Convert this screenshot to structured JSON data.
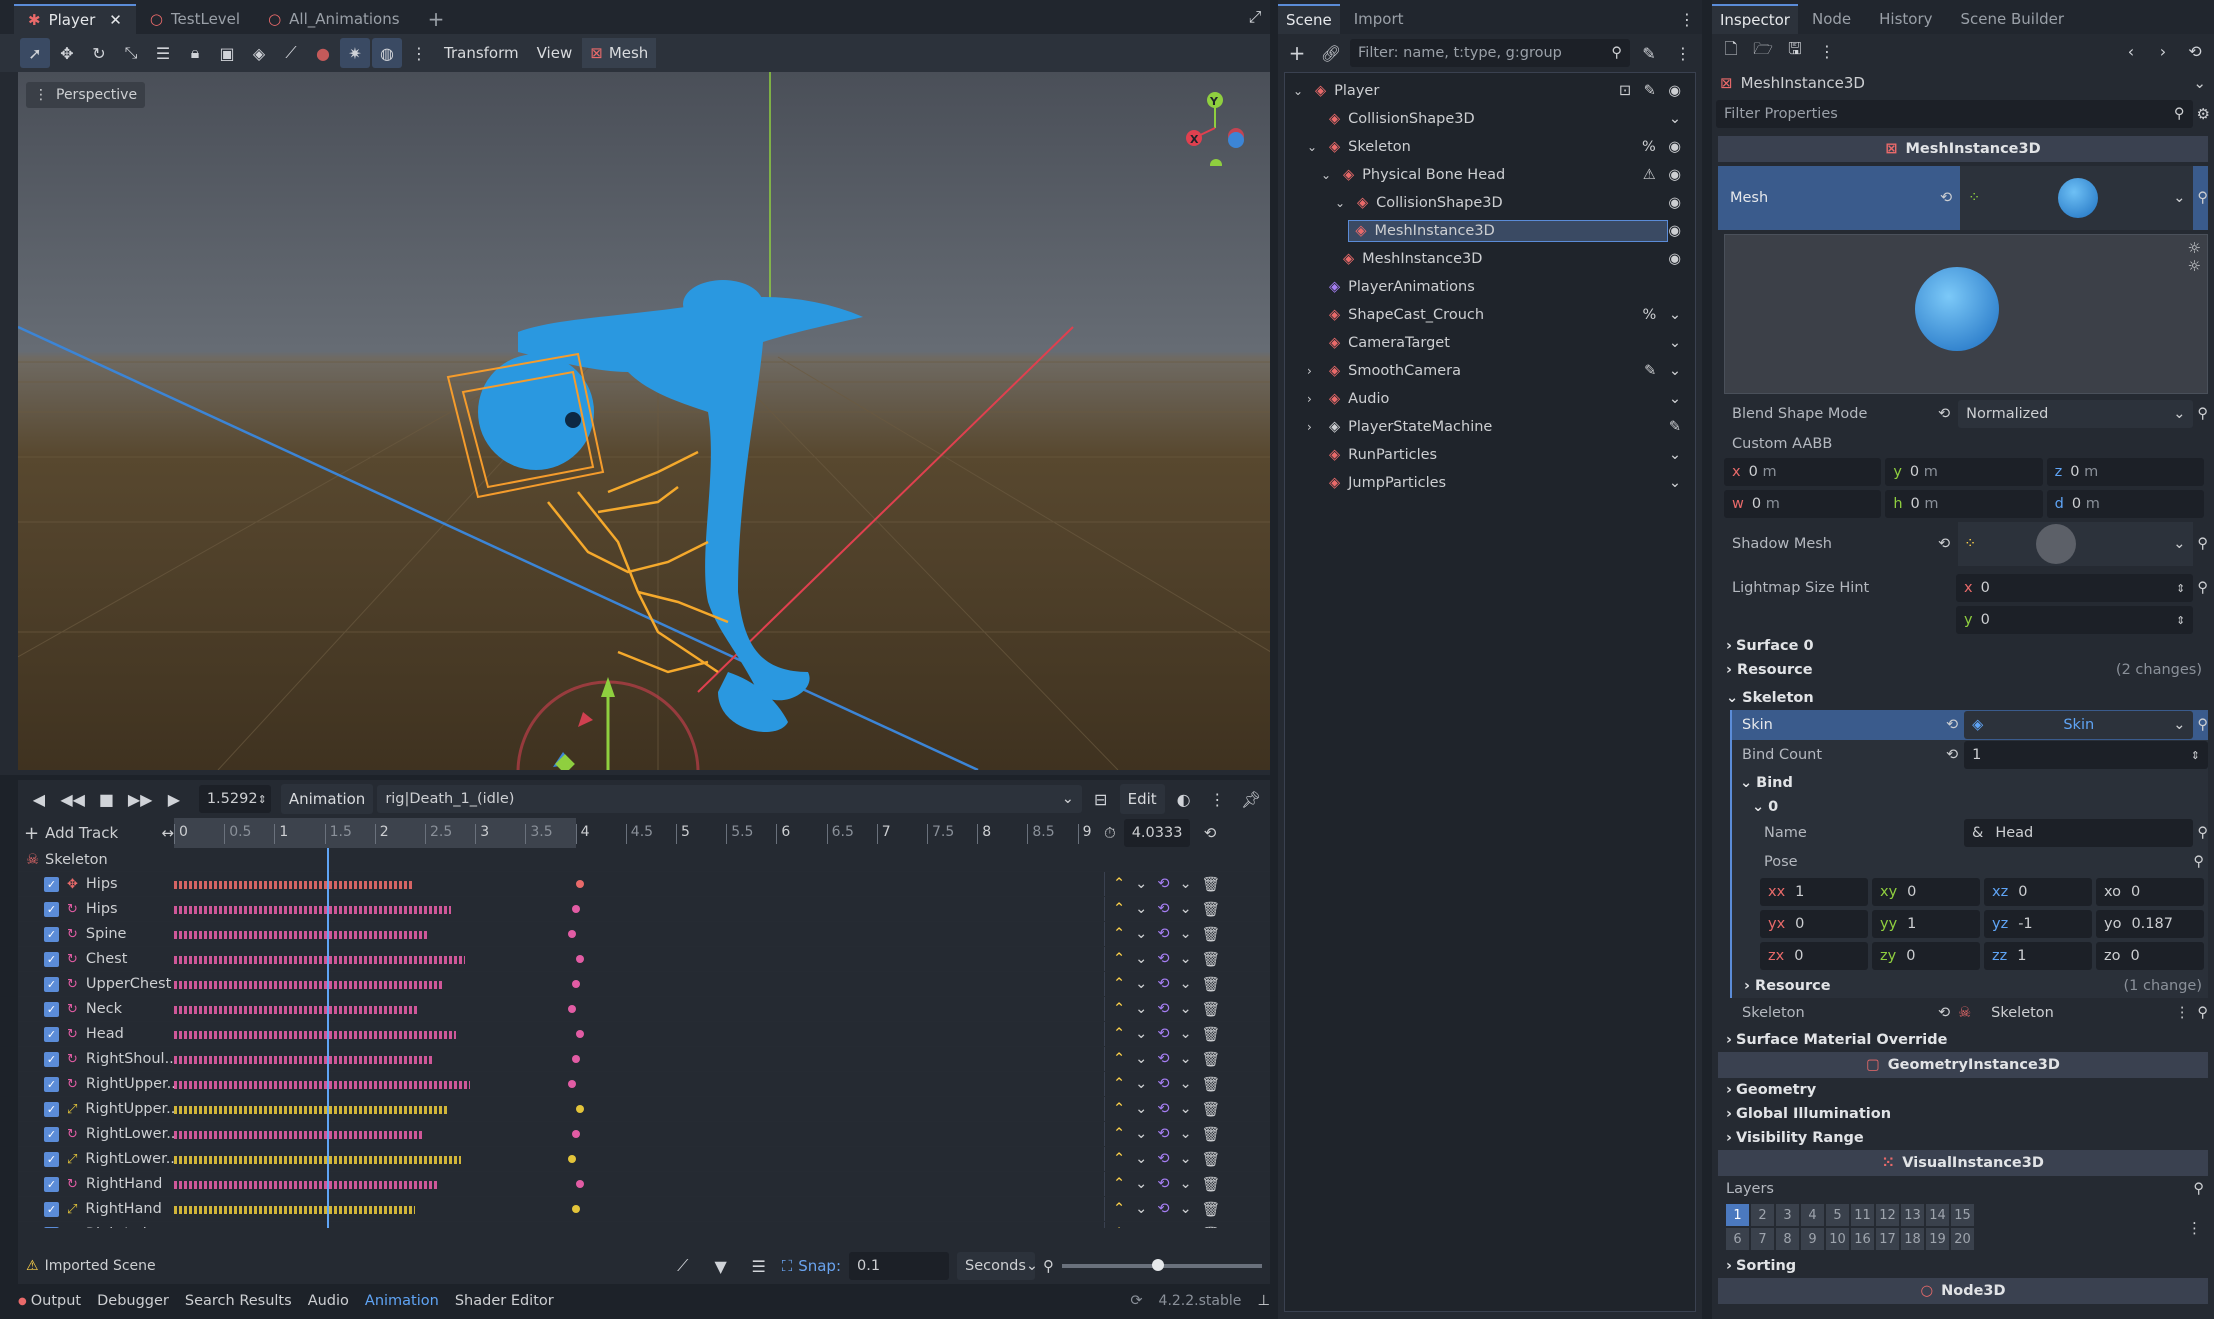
{
  "viewport": {
    "tabs": [
      {
        "label": "Player",
        "active": true
      },
      {
        "label": "TestLevel",
        "active": false
      },
      {
        "label": "All_Animations",
        "active": false
      }
    ],
    "toolbar": {
      "transform": "Transform",
      "view": "View",
      "mesh": "Mesh"
    },
    "perspective": "Perspective",
    "gizmo": {
      "y": "Y",
      "x": "X"
    }
  },
  "animation": {
    "time": "1.5292",
    "animation_menu": "Animation",
    "current_anim": "rig|Death_1_(idle)",
    "edit": "Edit",
    "add_track": "Add Track",
    "ruler": [
      "0",
      "0.5",
      "1",
      "1.5",
      "2",
      "2.5",
      "3",
      "3.5",
      "4",
      "4.5",
      "5",
      "5.5",
      "6",
      "6.5",
      "7",
      "7.5",
      "8",
      "8.5",
      "9"
    ],
    "length": "4.0333",
    "group": "Skeleton",
    "tracks": [
      {
        "name": "Hips",
        "kind": "pos"
      },
      {
        "name": "Hips",
        "kind": "rot"
      },
      {
        "name": "Spine",
        "kind": "rot"
      },
      {
        "name": "Chest",
        "kind": "rot"
      },
      {
        "name": "UpperChest",
        "kind": "rot"
      },
      {
        "name": "Neck",
        "kind": "rot"
      },
      {
        "name": "Head",
        "kind": "rot"
      },
      {
        "name": "RightShoul...",
        "kind": "rot"
      },
      {
        "name": "RightUpper...",
        "kind": "rot"
      },
      {
        "name": "RightUpper...",
        "kind": "scale"
      },
      {
        "name": "RightLower...",
        "kind": "rot"
      },
      {
        "name": "RightLower...",
        "kind": "scale"
      },
      {
        "name": "RightHand",
        "kind": "rot"
      },
      {
        "name": "RightHand",
        "kind": "scale"
      },
      {
        "name": "RightIndex...",
        "kind": "rot"
      }
    ],
    "imported_scene": "Imported Scene",
    "snap_label": "Snap:",
    "snap_value": "0.1",
    "seconds": "Seconds"
  },
  "bottom_panel": {
    "tabs": [
      "Output",
      "Debugger",
      "Search Results",
      "Audio",
      "Animation",
      "Shader Editor"
    ],
    "active": "Animation",
    "version": "4.2.2.stable"
  },
  "scene": {
    "tabs": [
      "Scene",
      "Import"
    ],
    "filter_placeholder": "Filter: name, t:type, g:group",
    "nodes": [
      {
        "label": "Player",
        "depth": 0,
        "color": "#e96a6a"
      },
      {
        "label": "CollisionShape3D",
        "depth": 1,
        "color": "#e96a6a"
      },
      {
        "label": "Skeleton",
        "depth": 1,
        "color": "#e96a6a"
      },
      {
        "label": "Physical Bone Head",
        "depth": 2,
        "color": "#e96a6a"
      },
      {
        "label": "CollisionShape3D",
        "depth": 3,
        "color": "#e96a6a"
      },
      {
        "label": "MeshInstance3D",
        "depth": 3,
        "color": "#e96a6a",
        "selected": true
      },
      {
        "label": "MeshInstance3D",
        "depth": 2,
        "color": "#e96a6a"
      },
      {
        "label": "PlayerAnimations",
        "depth": 1,
        "color": "#a57ef2"
      },
      {
        "label": "ShapeCast_Crouch",
        "depth": 1,
        "color": "#e96a6a"
      },
      {
        "label": "CameraTarget",
        "depth": 1,
        "color": "#e96a6a"
      },
      {
        "label": "SmoothCamera",
        "depth": 1,
        "color": "#e96a6a"
      },
      {
        "label": "Audio",
        "depth": 1,
        "color": "#e96a6a"
      },
      {
        "label": "PlayerStateMachine",
        "depth": 1,
        "color": "#cdcfd2"
      },
      {
        "label": "RunParticles",
        "depth": 1,
        "color": "#e96a6a"
      },
      {
        "label": "JumpParticles",
        "depth": 1,
        "color": "#e96a6a"
      }
    ]
  },
  "inspector": {
    "tabs": [
      "Inspector",
      "Node",
      "History",
      "Scene Builder"
    ],
    "object": "MeshInstance3D",
    "filter_placeholder": "Filter Properties",
    "class_header": "MeshInstance3D",
    "mesh_label": "Mesh",
    "blend_shape_mode": {
      "label": "Blend Shape Mode",
      "value": "Normalized"
    },
    "custom_aabb": {
      "label": "Custom AABB",
      "x": "0",
      "y": "0",
      "z": "0",
      "w": "0",
      "h": "0",
      "d": "0",
      "unit": "m"
    },
    "shadow_mesh": "Shadow Mesh",
    "lightmap": {
      "label": "Lightmap Size Hint",
      "x": "0",
      "y": "0"
    },
    "surface0": "Surface 0",
    "resource": {
      "label": "Resource",
      "changes": "(2 changes)"
    },
    "skeleton_section": "Skeleton",
    "skin": {
      "label": "Skin",
      "value": "Skin"
    },
    "bind_count": {
      "label": "Bind Count",
      "value": "1"
    },
    "bind": "Bind",
    "bind0": "0",
    "name": {
      "label": "Name",
      "value": "Head"
    },
    "pose": {
      "label": "Pose",
      "xx": "1",
      "xy": "0",
      "xz": "0",
      "xo": "0",
      "yx": "0",
      "yy": "1",
      "yz": "-1",
      "yo": "0.187",
      "zx": "0",
      "zy": "0",
      "zz": "1",
      "zo": "0"
    },
    "resource2": {
      "label": "Resource",
      "changes": "(1 change)"
    },
    "skeleton_prop": {
      "label": "Skeleton",
      "value": "Skeleton"
    },
    "surface_material": "Surface Material Override",
    "geometry_header": "GeometryInstance3D",
    "geometry": "Geometry",
    "gi": "Global Illumination",
    "visibility": "Visibility Range",
    "visual_header": "VisualInstance3D",
    "layers": "Layers",
    "layer_nums": [
      "1",
      "2",
      "3",
      "4",
      "5",
      "11",
      "12",
      "13",
      "14",
      "15",
      "6",
      "7",
      "8",
      "9",
      "10",
      "16",
      "17",
      "18",
      "19",
      "20"
    ],
    "sorting": "Sorting",
    "node3d_header": "Node3D"
  }
}
